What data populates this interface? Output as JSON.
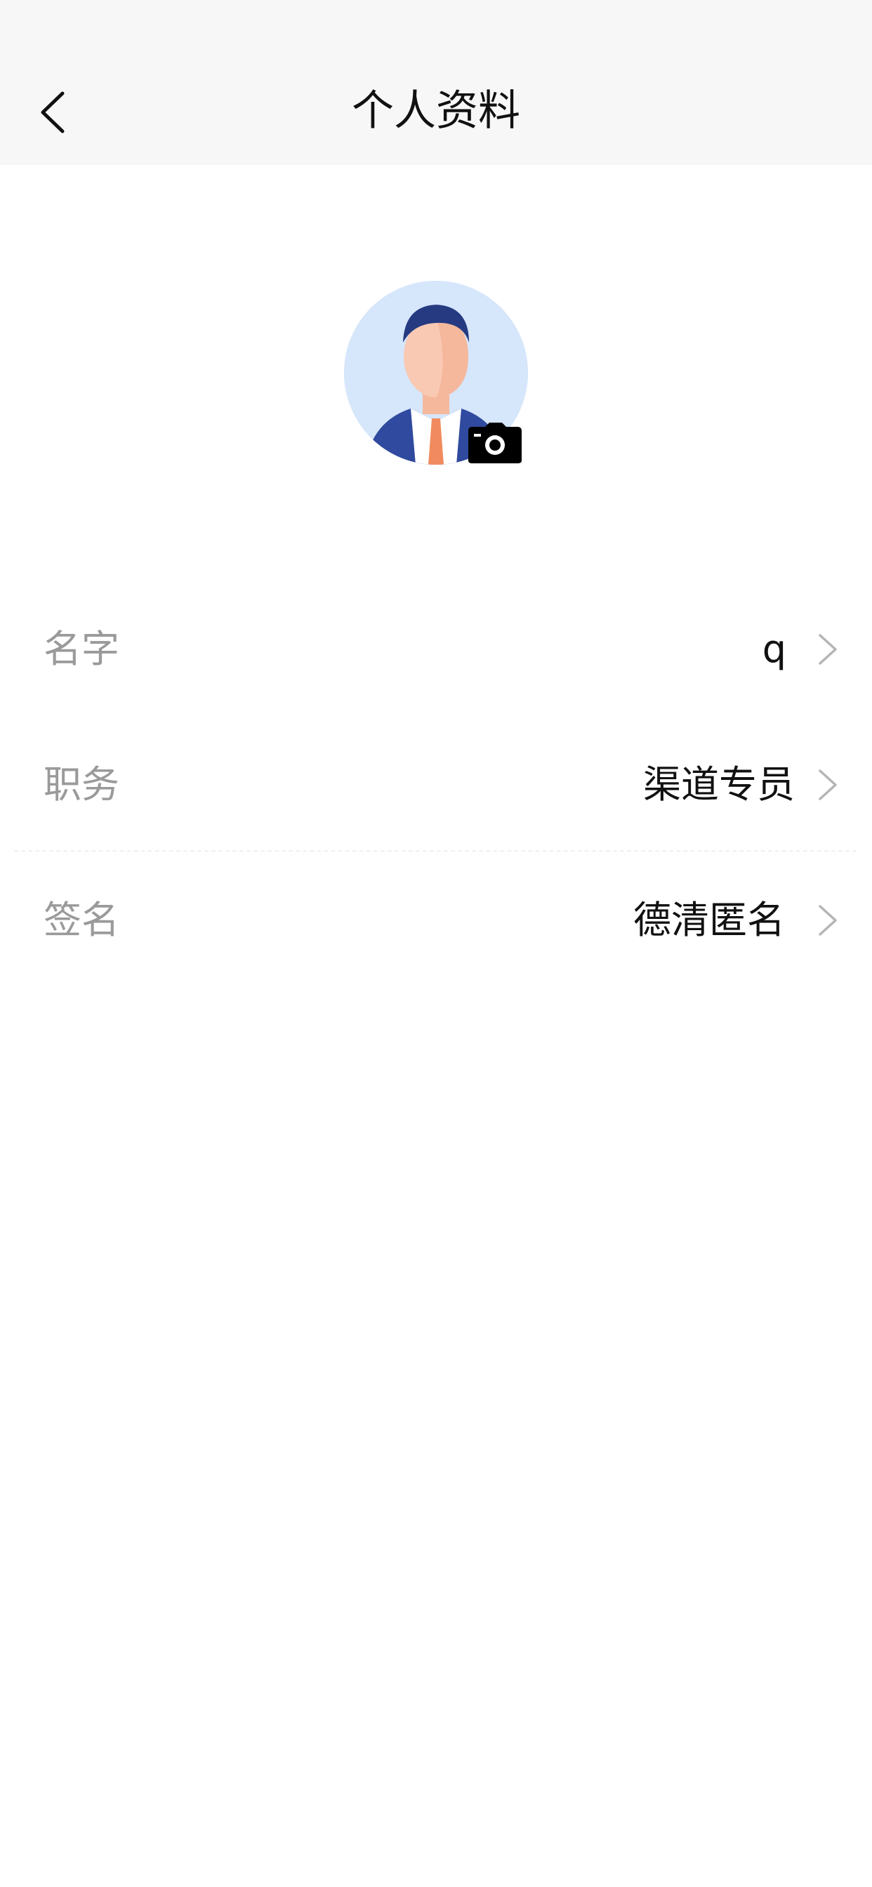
{
  "header": {
    "title": "个人资料",
    "back_icon": "chevron-left-icon"
  },
  "avatar": {
    "icon": "camera-icon",
    "background_color": "#d6e6fb"
  },
  "profile_rows": [
    {
      "label": "名字",
      "value": "q"
    },
    {
      "label": "职务",
      "value": "渠道专员"
    },
    {
      "label": "签名",
      "value": "德清匿名"
    }
  ],
  "colors": {
    "header_bg": "#f7f7f7",
    "label_text": "#9a9a9a",
    "value_text": "#111111",
    "chevron": "#b5b5b5"
  }
}
